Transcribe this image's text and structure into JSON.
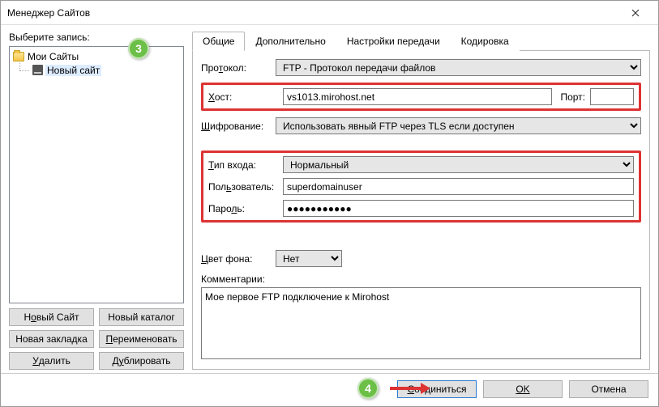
{
  "window": {
    "title": "Менеджер Сайтов"
  },
  "left": {
    "label": "Выберите запись:",
    "root": "Мои Сайты",
    "site": "Новый сайт",
    "buttons": {
      "new_site_pre": "Н",
      "new_site_u": "о",
      "new_site_post": "вый Сайт",
      "new_folder": "Новый каталог",
      "new_bookmark": "Новая закладка",
      "rename_pre": "",
      "rename_u": "П",
      "rename_post": "ереименовать",
      "delete_pre": "",
      "delete_u": "У",
      "delete_post": "далить",
      "duplicate_pre": "Д",
      "duplicate_u": "у",
      "duplicate_post": "блировать"
    }
  },
  "tabs": {
    "general": "Общие",
    "advanced": "Дополнительно",
    "transfer": "Настройки передачи",
    "charset": "Кодировка"
  },
  "form": {
    "protocol_label_pre": "Про",
    "protocol_label_u": "т",
    "protocol_label_post": "окол:",
    "protocol_value": "FTP - Протокол передачи файлов",
    "host_label_u": "Х",
    "host_label_post": "ост:",
    "host_value": "vs1013.mirohost.net",
    "port_label_u": "П",
    "port_label_post": "орт:",
    "port_value": "",
    "encryption_label_u": "Ш",
    "encryption_label_post": "ифрование:",
    "encryption_value": "Использовать явный FTP через TLS если доступен",
    "logon_label_u": "Т",
    "logon_label_post": "ип входа:",
    "logon_value": "Нормальный",
    "user_label_pre": "Пол",
    "user_label_u": "ь",
    "user_label_post": "зователь:",
    "user_value": "superdomainuser",
    "pass_label_pre": "Паро",
    "pass_label_u": "л",
    "pass_label_post": "ь:",
    "pass_value": "●●●●●●●●●●●",
    "bg_label_u": "Ц",
    "bg_label_post": "вет фона:",
    "bg_value": "Нет",
    "comments_label_pre": "Ко",
    "comments_label_u": "м",
    "comments_label_post": "ментарии:",
    "comments_value": "Мое первое FTP подключение к Mirohost"
  },
  "footer": {
    "connect_u": "С",
    "connect_post": "оединиться",
    "ok": "OK",
    "cancel": "Отмена"
  },
  "badges": {
    "b3": "3",
    "b4": "4"
  }
}
